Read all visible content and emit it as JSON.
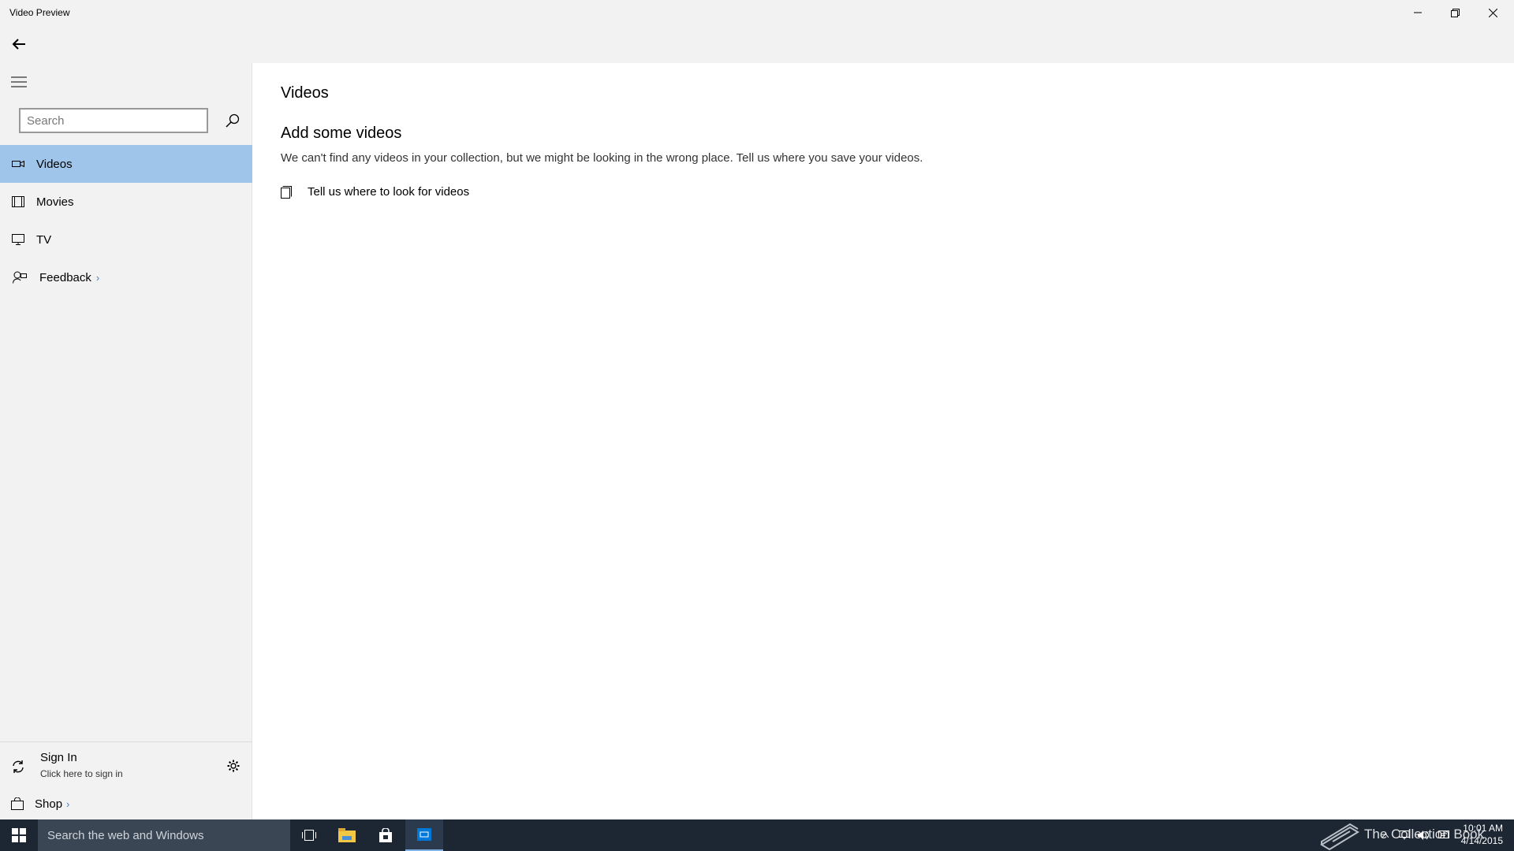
{
  "window": {
    "title": "Video Preview"
  },
  "sidebar": {
    "search_placeholder": "Search",
    "items": [
      {
        "label": "Videos",
        "icon": "video-camera-icon",
        "selected": true
      },
      {
        "label": "Movies",
        "icon": "film-icon",
        "selected": false
      },
      {
        "label": "TV",
        "icon": "tv-icon",
        "selected": false
      },
      {
        "label": "Feedback",
        "icon": "feedback-icon",
        "selected": false,
        "chevron": "›"
      }
    ],
    "sign_in": {
      "label": "Sign In",
      "sublabel": "Click here to sign in"
    },
    "shop": {
      "label": "Shop",
      "chevron": "›"
    }
  },
  "main": {
    "page_title": "Videos",
    "section_title": "Add some videos",
    "section_desc": "We can't find any videos in your collection, but we might be looking in the wrong place. Tell us where you save your videos.",
    "folder_link": "Tell us where to look for videos"
  },
  "taskbar": {
    "search_text": "Search the web and Windows",
    "tray_text": "The Collection Book",
    "time": "10:01 AM",
    "date": "4/14/2015"
  },
  "colors": {
    "selected_bg": "#9fc6ea",
    "sidebar_bg": "#f2f2f2",
    "taskbar_bg": "#1c2733",
    "accent": "#0078d7"
  }
}
